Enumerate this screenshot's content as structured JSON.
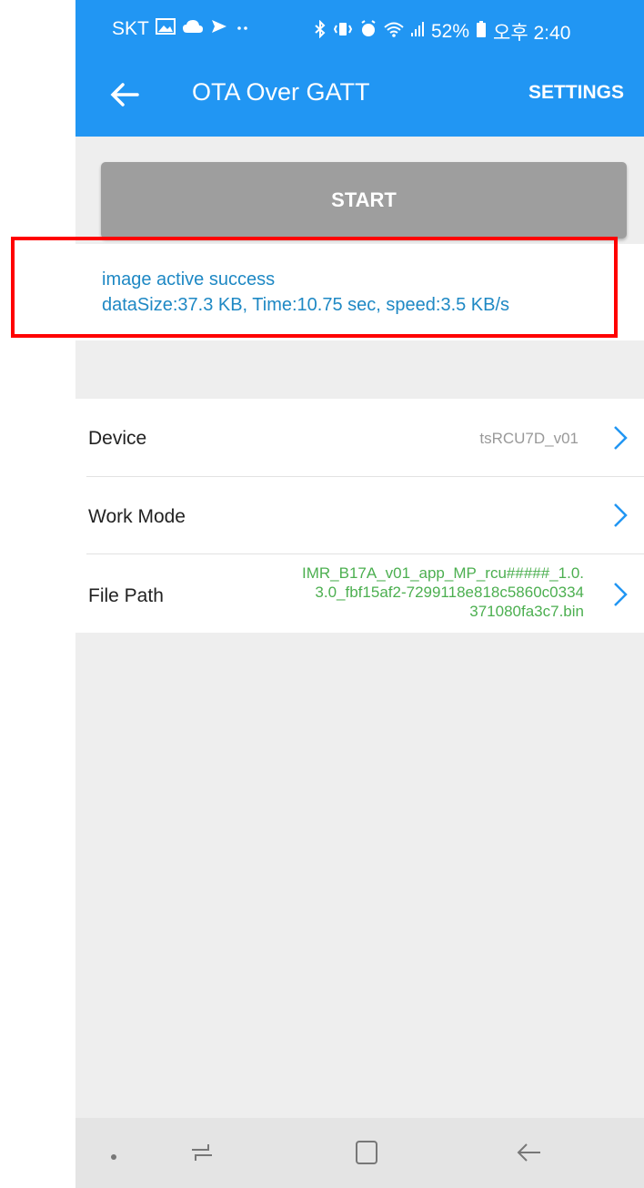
{
  "status_bar": {
    "carrier": "SKT",
    "battery": "52%",
    "time": "오후 2:40",
    "icons_left": [
      "gallery-icon",
      "cloud-icon",
      "send-icon",
      "more-dots-icon"
    ],
    "icons_right": [
      "bluetooth-icon",
      "vibrate-icon",
      "alarm-icon",
      "wifi-icon",
      "signal-icon",
      "battery-icon"
    ]
  },
  "app_bar": {
    "title": "OTA Over GATT",
    "settings_label": "SETTINGS"
  },
  "start_button": {
    "label": "START"
  },
  "status": {
    "line1": "image active success",
    "line2": "dataSize:37.3 KB, Time:10.75 sec, speed:3.5 KB/s"
  },
  "settings_list": {
    "device": {
      "label": "Device",
      "value": "tsRCU7D_v01"
    },
    "work_mode": {
      "label": "Work Mode",
      "value": ""
    },
    "file_path": {
      "label": "File Path",
      "value_lines": [
        "IMR_B17A_v01_app_MP_rcu#####_1.0.",
        "3.0_fbf15af2-7299118e818c5860c0334",
        "371080fa3c7.bin"
      ]
    }
  },
  "colors": {
    "primary": "#2196f3",
    "status_text": "#1e88c4",
    "path_text": "#4caf50",
    "highlight_border": "#ff0000",
    "disabled_button": "#9e9e9e"
  }
}
